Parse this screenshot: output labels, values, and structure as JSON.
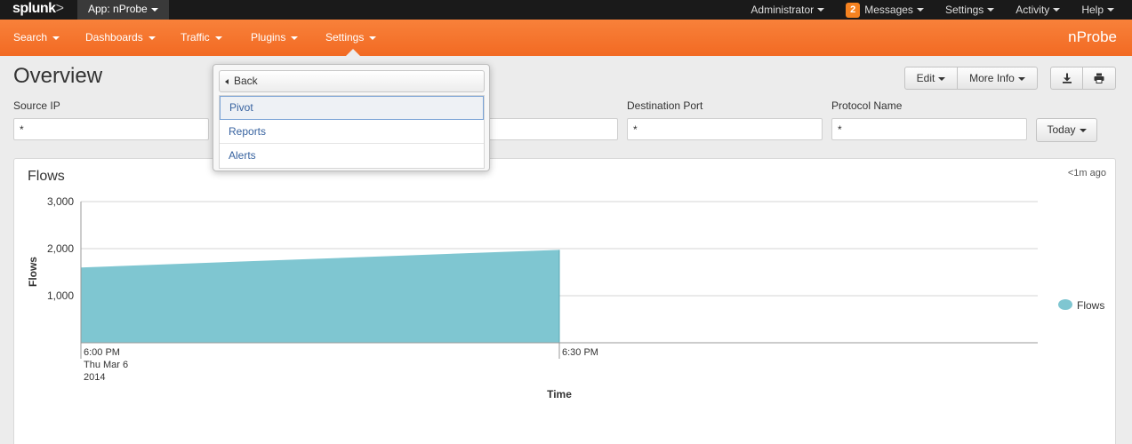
{
  "topbar": {
    "logo": "splunk",
    "logo_suffix": ">",
    "app_label": "App: nProbe",
    "items": [
      {
        "label": "Administrator"
      },
      {
        "label": "Messages",
        "badge": "2"
      },
      {
        "label": "Settings"
      },
      {
        "label": "Activity"
      },
      {
        "label": "Help"
      }
    ]
  },
  "nav": {
    "items": [
      {
        "label": "Search"
      },
      {
        "label": "Dashboards"
      },
      {
        "label": "Traffic"
      },
      {
        "label": "Plugins"
      },
      {
        "label": "Settings"
      }
    ],
    "app_title": "nProbe"
  },
  "page": {
    "title": "Overview",
    "edit_label": "Edit",
    "more_info_label": "More Info",
    "export_icon": "download-icon",
    "print_icon": "print-icon"
  },
  "filters": {
    "source_ip_label": "Source IP",
    "source_ip_value": "*",
    "hidden_value": "",
    "destination_port_label": "Destination Port",
    "destination_port_value": "*",
    "protocol_name_label": "Protocol Name",
    "protocol_name_value": "*",
    "time_label": "Today"
  },
  "dropdown": {
    "back_label": "Back",
    "items": [
      {
        "label": "Pivot",
        "active": true
      },
      {
        "label": "Reports"
      },
      {
        "label": "Alerts"
      }
    ]
  },
  "panel": {
    "title": "Flows",
    "updated": "<1m ago"
  },
  "chart_data": {
    "type": "area",
    "x": [
      "6:00 PM",
      "6:30 PM"
    ],
    "series": [
      {
        "name": "Flows",
        "values": [
          1600,
          1975
        ],
        "color": "#7fc6d1"
      }
    ],
    "y_ticks": [
      "1,000",
      "2,000",
      "3,000"
    ],
    "x_tick_labels": [
      {
        "lines": [
          "6:00 PM",
          "Thu Mar 6",
          "2014"
        ]
      },
      {
        "lines": [
          "6:30 PM"
        ]
      }
    ],
    "xlabel": "Time",
    "ylabel": "Flows",
    "ylim": [
      0,
      3000
    ],
    "grid": true,
    "legend": "right"
  }
}
